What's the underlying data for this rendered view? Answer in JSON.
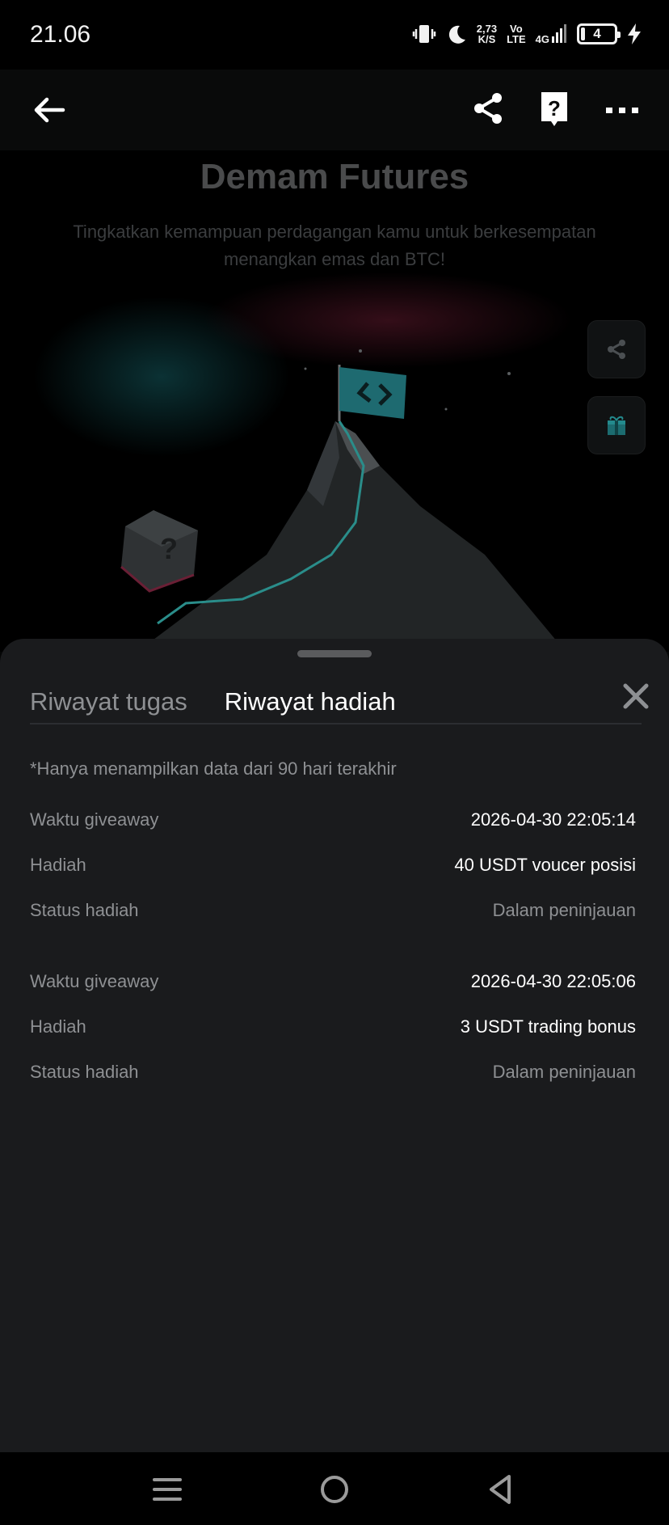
{
  "status_bar": {
    "time": "21.06",
    "net_speed_top": "2,73",
    "net_speed_bottom": "K/S",
    "volte_top": "Vo",
    "volte_bottom": "LTE",
    "network": "4G",
    "battery": "4",
    "icons": [
      "vibrate-icon",
      "moon-icon",
      "signal-icon",
      "battery-icon",
      "charging-icon"
    ]
  },
  "app_bar": {
    "icons": [
      "back-arrow-icon",
      "share-icon",
      "help-icon",
      "more-icon"
    ]
  },
  "hero": {
    "title": "Demam Futures",
    "subtitle": "Tingkatkan kemampuan perdagangan kamu untuk berkesempatan menangkan emas dan BTC!",
    "side_buttons": [
      "share-icon",
      "gift-icon"
    ]
  },
  "sheet": {
    "tabs": [
      {
        "label": "Riwayat tugas",
        "active": false
      },
      {
        "label": "Riwayat hadiah",
        "active": true
      }
    ],
    "note": "*Hanya menampilkan data dari 90 hari terakhir",
    "records": [
      {
        "time_label": "Waktu giveaway",
        "time_value": "2026-04-30 22:05:14",
        "reward_label": "Hadiah",
        "reward_value": "40 USDT voucer posisi",
        "status_label": "Status hadiah",
        "status_value": "Dalam peninjauan"
      },
      {
        "time_label": "Waktu giveaway",
        "time_value": "2026-04-30 22:05:06",
        "reward_label": "Hadiah",
        "reward_value": "3 USDT trading bonus",
        "status_label": "Status hadiah",
        "status_value": "Dalam peninjauan"
      }
    ]
  },
  "nav_bar": {
    "icons": [
      "recent-apps-icon",
      "home-icon",
      "back-icon"
    ]
  },
  "colors": {
    "sheet_bg": "#1a1b1d",
    "muted_text": "#8e9093",
    "accent_teal": "#2fa5a0"
  }
}
